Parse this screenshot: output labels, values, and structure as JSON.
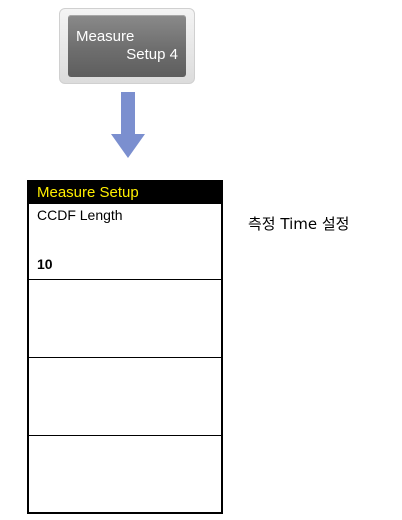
{
  "hard_key": {
    "line1": "Measure",
    "line2": "Setup 4"
  },
  "arrow_icon": "down-arrow",
  "softkey_menu": {
    "title": "Measure Setup",
    "keys": [
      {
        "label": "CCDF Length",
        "value": "10"
      },
      {
        "label": "",
        "value": ""
      },
      {
        "label": "",
        "value": ""
      },
      {
        "label": "",
        "value": ""
      }
    ]
  },
  "annotation": "측정 Time 설정",
  "colors": {
    "menu_title_text": "#ffee00",
    "menu_title_bg": "#000000",
    "arrow": "#7b8fcf",
    "hard_key": "#707070"
  }
}
